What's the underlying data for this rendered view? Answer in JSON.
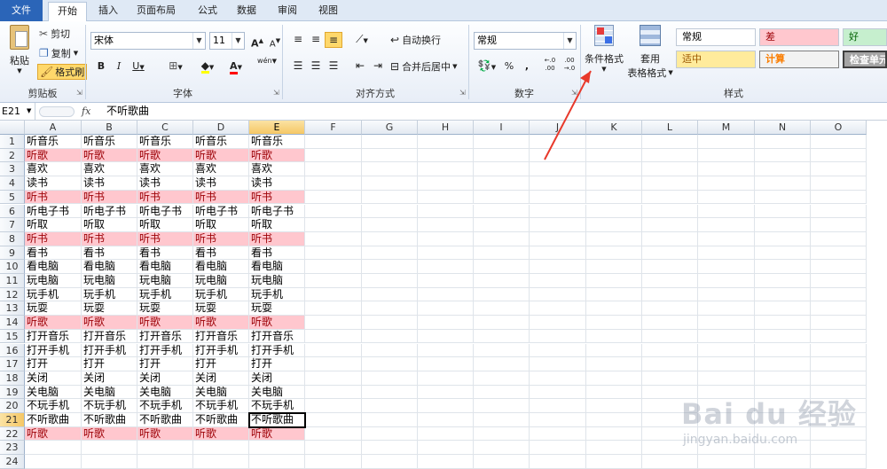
{
  "tabs": [
    {
      "id": "file",
      "label": "文件"
    },
    {
      "id": "home",
      "label": "开始"
    },
    {
      "id": "insert",
      "label": "插入"
    },
    {
      "id": "layout",
      "label": "页面布局"
    },
    {
      "id": "formula",
      "label": "公式"
    },
    {
      "id": "data",
      "label": "数据"
    },
    {
      "id": "review",
      "label": "审阅"
    },
    {
      "id": "view",
      "label": "视图"
    }
  ],
  "ribbon": {
    "clipboard": {
      "paste": "粘贴",
      "cut": "剪切",
      "copy": "复制",
      "format_painter": "格式刷",
      "label": "剪贴板"
    },
    "font": {
      "name": "宋体",
      "size": "11",
      "bold": "B",
      "italic": "I",
      "underline": "U",
      "label": "字体",
      "grow": "A",
      "shrink": "A",
      "font_color_glyph": "A",
      "phonetic": "wén"
    },
    "alignment": {
      "wrap": "自动换行",
      "merge": "合并后居中",
      "label": "对齐方式"
    },
    "number": {
      "format": "常规",
      "percent": "%",
      "comma": ",",
      "label": "数字",
      "inc_decimal": "←.0\n.00",
      "dec_decimal": ".00\n→.0"
    },
    "styles": {
      "conditional": "条件格式",
      "table_line1": "套用",
      "table_line2": "表格格式",
      "label": "样式",
      "cells": [
        {
          "name": "常规",
          "bg": "#ffffff",
          "fg": "#000000"
        },
        {
          "name": "差",
          "bg": "#ffc7ce",
          "fg": "#9c0006"
        },
        {
          "name": "好",
          "bg": "#c6efce",
          "fg": "#006100"
        },
        {
          "name": "适中",
          "bg": "#ffeb9c",
          "fg": "#9c5700"
        },
        {
          "name": "计算",
          "bg": "#f2f2f2",
          "fg": "#fa7d00"
        },
        {
          "name": "检查单元",
          "bg": "#a5a5a5",
          "fg": "#ffffff"
        }
      ]
    }
  },
  "formula_bar": {
    "name_box": "E21",
    "fx": "fx",
    "content": "不听歌曲"
  },
  "columns": [
    "A",
    "B",
    "C",
    "D",
    "E",
    "F",
    "G",
    "H",
    "I",
    "J",
    "K",
    "L",
    "M",
    "N",
    "O"
  ],
  "selected_column": "E",
  "rows": [
    {
      "n": "1",
      "text": "听音乐",
      "highlight": false
    },
    {
      "n": "2",
      "text": "听歌",
      "highlight": true
    },
    {
      "n": "3",
      "text": "喜欢",
      "highlight": false
    },
    {
      "n": "4",
      "text": "读书",
      "highlight": false
    },
    {
      "n": "5",
      "text": "听书",
      "highlight": true
    },
    {
      "n": "6",
      "text": "听电子书",
      "highlight": false
    },
    {
      "n": "7",
      "text": "听取",
      "highlight": false
    },
    {
      "n": "8",
      "text": "听书",
      "highlight": true
    },
    {
      "n": "9",
      "text": "看书",
      "highlight": false
    },
    {
      "n": "10",
      "text": "看电脑",
      "highlight": false
    },
    {
      "n": "11",
      "text": "玩电脑",
      "highlight": false
    },
    {
      "n": "12",
      "text": "玩手机",
      "highlight": false
    },
    {
      "n": "13",
      "text": "玩耍",
      "highlight": false
    },
    {
      "n": "14",
      "text": "听歌",
      "highlight": true
    },
    {
      "n": "15",
      "text": "打开音乐",
      "highlight": false
    },
    {
      "n": "16",
      "text": "打开手机",
      "highlight": false
    },
    {
      "n": "17",
      "text": "打开",
      "highlight": false
    },
    {
      "n": "18",
      "text": "关闭",
      "highlight": false
    },
    {
      "n": "19",
      "text": "关电脑",
      "highlight": false
    },
    {
      "n": "20",
      "text": "不玩手机",
      "highlight": false
    },
    {
      "n": "21",
      "text": "不听歌曲",
      "highlight": false
    },
    {
      "n": "22",
      "text": "听歌",
      "highlight": true
    },
    {
      "n": "23",
      "text": "",
      "highlight": false
    },
    {
      "n": "24",
      "text": "",
      "highlight": false
    }
  ],
  "active_cell": {
    "row": "21",
    "col": "E"
  },
  "annotation": {
    "color": "#e8392b"
  },
  "watermark": {
    "brand": "Bai du 经验",
    "url": "jingyan.baidu.com"
  }
}
